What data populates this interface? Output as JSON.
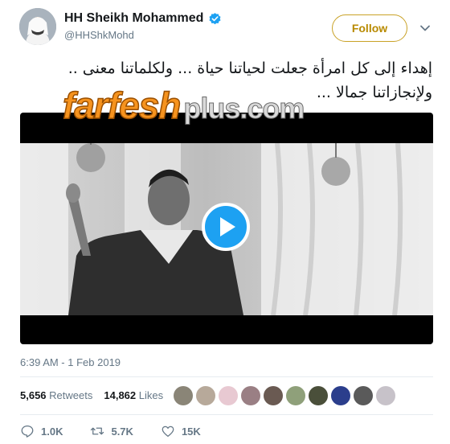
{
  "author": {
    "display_name": "HH Sheikh Mohammed",
    "handle": "@HHShkMohd",
    "verified": true
  },
  "follow_button": {
    "label": "Follow"
  },
  "tweet": {
    "text_line1": "إهداء إلى كل امرأة جعلت لحياتنا حياة ... ولكلماتنا معنى ..",
    "text_line2": "ولإنجازاتنا جمالا ..."
  },
  "watermark": {
    "main": "farfesh",
    "suffix": "plus.com"
  },
  "video": {
    "state": "paused",
    "play_icon": "play-icon"
  },
  "timestamp": "6:39 AM - 1 Feb 2019",
  "stats": {
    "retweets_count": "5,656",
    "retweets_label": "Retweets",
    "likes_count": "14,862",
    "likes_label": "Likes",
    "liker_avatar_colors": [
      "#8a8577",
      "#b7a99a",
      "#e8c9d2",
      "#9a7f84",
      "#6a5a52",
      "#8fa07a",
      "#4a4f3a",
      "#2b3e8c",
      "#5a5a5a",
      "#c7c2c9"
    ]
  },
  "actions": {
    "reply_count": "1.0K",
    "retweet_count": "5.7K",
    "like_count": "15K"
  },
  "colors": {
    "follow_accent": "#b88a00",
    "play_button": "#1da1f2",
    "verified_badge": "#1da1f2"
  }
}
